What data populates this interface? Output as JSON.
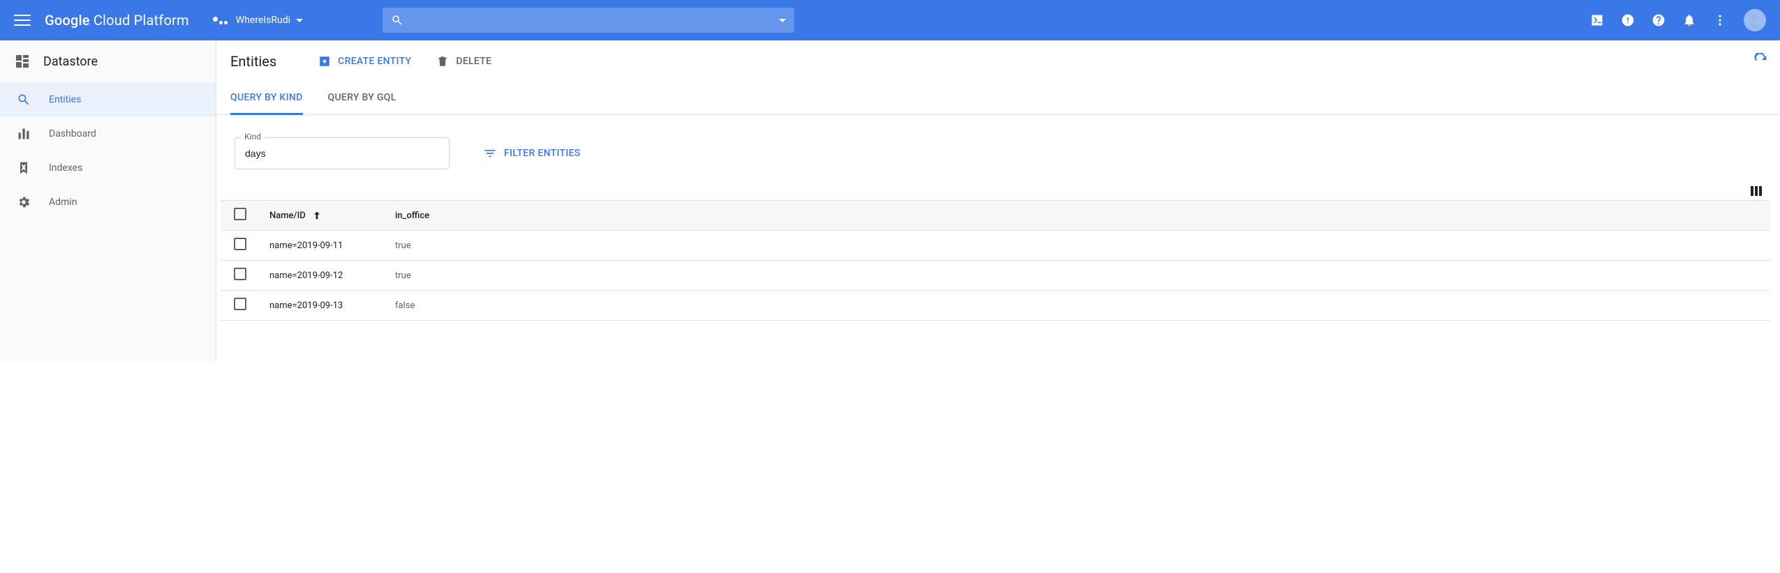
{
  "header": {
    "product": "Google Cloud Platform",
    "project": "WhereIsRudi"
  },
  "sidebar": {
    "title": "Datastore",
    "items": [
      {
        "label": "Entities"
      },
      {
        "label": "Dashboard"
      },
      {
        "label": "Indexes"
      },
      {
        "label": "Admin"
      }
    ]
  },
  "page": {
    "title": "Entities",
    "create_label": "CREATE ENTITY",
    "delete_label": "DELETE"
  },
  "tabs": {
    "kind": "QUERY BY KIND",
    "gql": "QUERY BY GQL"
  },
  "query": {
    "kind_label": "Kind",
    "kind_value": "days",
    "filter_label": "FILTER ENTITIES"
  },
  "table": {
    "cols": {
      "name": "Name/ID",
      "in_office": "in_office"
    },
    "rows": [
      {
        "name": "name=2019-09-11",
        "in_office": "true"
      },
      {
        "name": "name=2019-09-12",
        "in_office": "true"
      },
      {
        "name": "name=2019-09-13",
        "in_office": "false"
      }
    ]
  }
}
